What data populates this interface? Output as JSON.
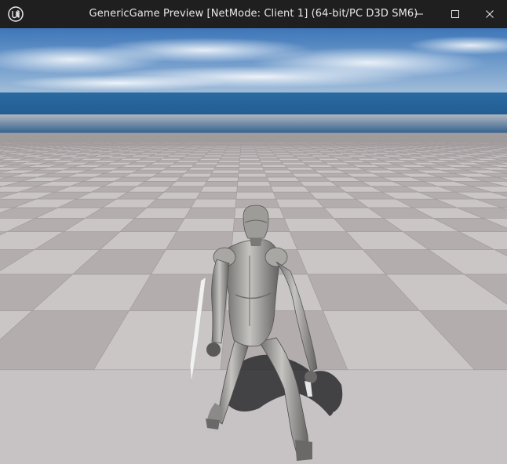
{
  "window": {
    "title": "GenericGame Preview [NetMode: Client 1]  (64-bit/PC D3D SM6)",
    "app_icon": "unreal-engine-logo-icon",
    "controls": [
      "minimize-icon",
      "maximize-icon",
      "close-icon"
    ]
  },
  "scene": {
    "description_icon": "game-viewport",
    "sky_color": "#4f86c2",
    "ocean_color": "#1f5c8f",
    "floor_light": "#cbc6c6",
    "floor_dark": "#b3adae",
    "character_color": "#9a9a98"
  }
}
